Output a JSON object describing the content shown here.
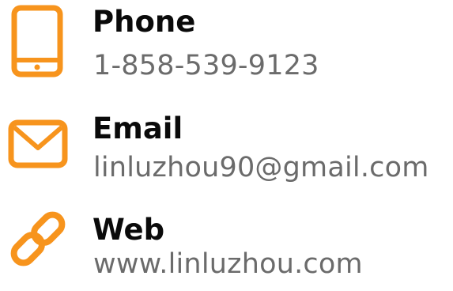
{
  "accent_color": "#F7941D",
  "contacts": {
    "phone": {
      "icon": "phone-icon",
      "label": "Phone",
      "value": "1-858-539-9123"
    },
    "email": {
      "icon": "envelope-icon",
      "label": "Email",
      "value": "linluzhou90@gmail.com"
    },
    "web": {
      "icon": "link-icon",
      "label": "Web",
      "value": "www.linluzhou.com"
    }
  }
}
